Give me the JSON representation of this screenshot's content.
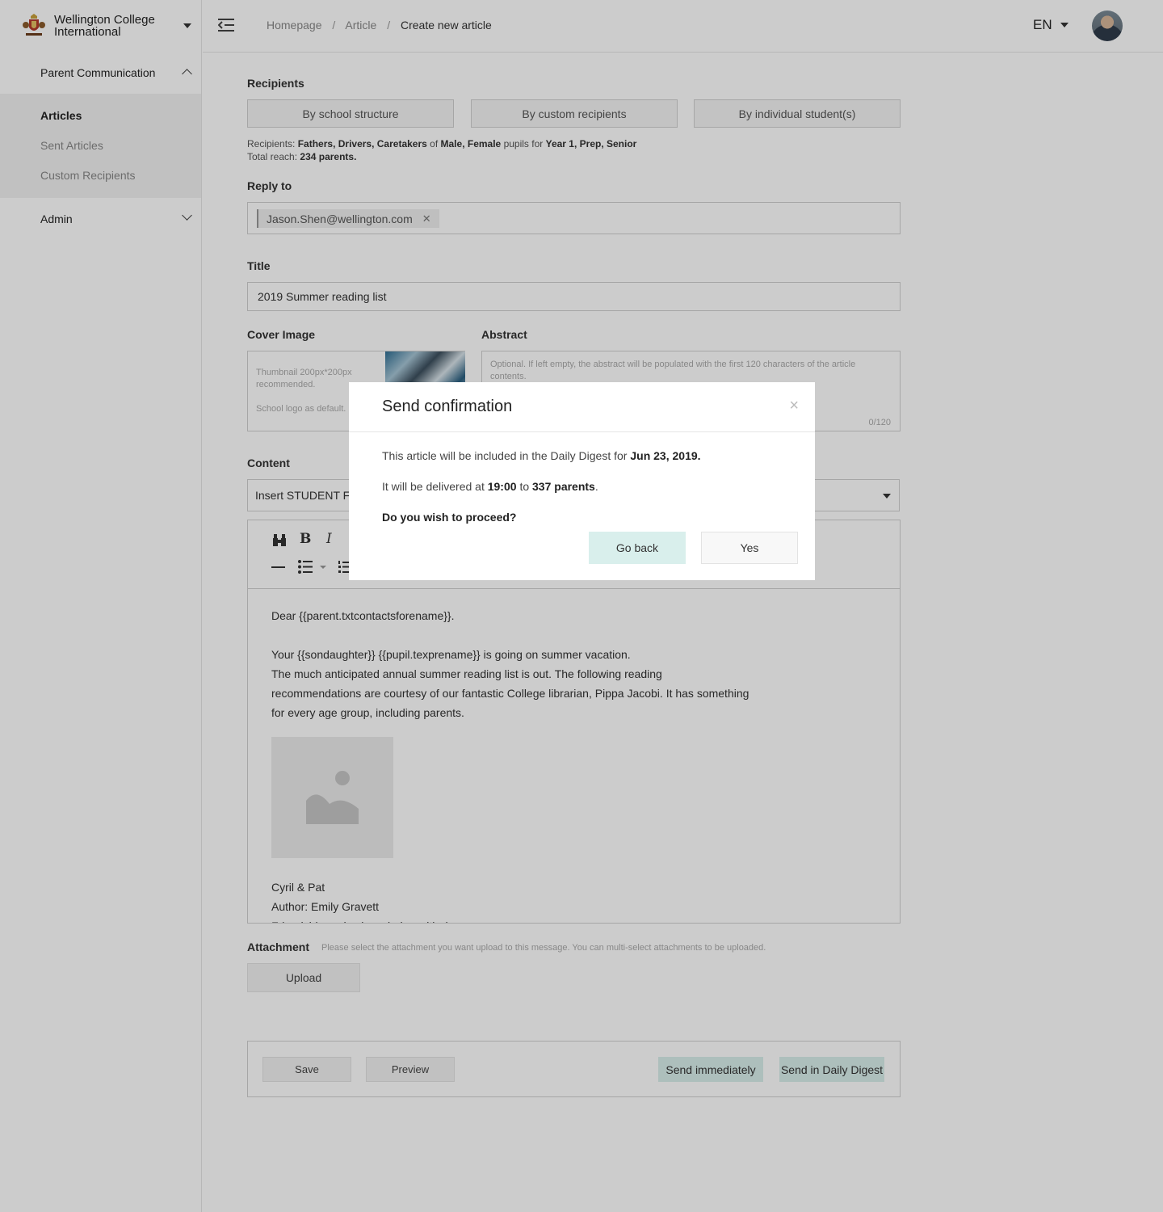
{
  "sidebar": {
    "org_name": "Wellington College International",
    "groups": [
      {
        "label": "Parent Communication",
        "expanded": true,
        "items": [
          {
            "label": "Articles",
            "active": true
          },
          {
            "label": "Sent Articles",
            "active": false
          },
          {
            "label": "Custom Recipients",
            "active": false
          }
        ]
      },
      {
        "label": "Admin",
        "expanded": false
      }
    ]
  },
  "header": {
    "breadcrumb": [
      "Homepage",
      "Article",
      "Create new article"
    ],
    "breadcrumb_sep": "/",
    "language": "EN"
  },
  "form": {
    "recipients_label": "Recipients",
    "recipient_modes": [
      "By school structure",
      "By custom recipients",
      "By individual student(s)"
    ],
    "recipients_summary": {
      "prefix": "Recipients:",
      "relations": "Fathers, Drivers, Caretakers",
      "of": "of",
      "genders": "Male, Female",
      "pupils_for": "pupils for",
      "years": "Year 1, Prep, Senior",
      "reach_prefix": "Total reach:",
      "reach_value": "234 parents."
    },
    "reply_to_label": "Reply to",
    "reply_to_tag": "Jason.Shen@wellington.com",
    "title_label": "Title",
    "title_value": "2019 Summer reading list",
    "cover_label": "Cover Image",
    "cover_placeholder_1": "Thumbnail  200px*200px recommended.",
    "cover_placeholder_2": "School logo as default.",
    "abstract_label": "Abstract",
    "abstract_placeholder": "Optional. If left empty, the abstract will be populated with the first 120 characters of the article contents.",
    "abstract_counter": "0/120",
    "content_label": "Content",
    "insert_field_select": "Insert STUDENT Fie",
    "editor_lines": {
      "greeting": "Dear {{parent.txtcontactsforename}}.",
      "line1": "Your {{sondaughter}} {{pupil.texprename}} is going on summer vacation.",
      "line2": "The much anticipated annual summer reading list is out. The following reading",
      "line3": "recommendations are courtesy of our fantastic College librarian, Pippa Jacobi. It has something",
      "line4": "for every age group, including parents.",
      "book_title": "Cyril & Pat",
      "book_author": "Author: Emily Gravett",
      "book_desc": "Friendship and acknowledge with d..."
    },
    "attachment_label": "Attachment",
    "attachment_hint": "Please select the attachment you want upload to this message. You can multi-select attachments to be uploaded.",
    "upload_label": "Upload",
    "actions": {
      "save": "Save",
      "preview": "Preview",
      "send_now": "Send immediately",
      "send_digest": "Send in Daily Digest"
    }
  },
  "modal": {
    "title": "Send confirmation",
    "close_glyph": "×",
    "line1_prefix": "This article will be included in the Daily Digest for",
    "line1_date": "Jun 23, 2019.",
    "line2_prefix": "It will be delivered at",
    "line2_time": "19:00",
    "line2_to": "to",
    "line2_count": "337 parents",
    "line2_end": ".",
    "question": "Do you wish to proceed?",
    "go_back": "Go back",
    "yes": "Yes"
  },
  "colors": {
    "primary_button": "#d9efec",
    "overlay": "rgba(0,0,0,0.2)"
  }
}
